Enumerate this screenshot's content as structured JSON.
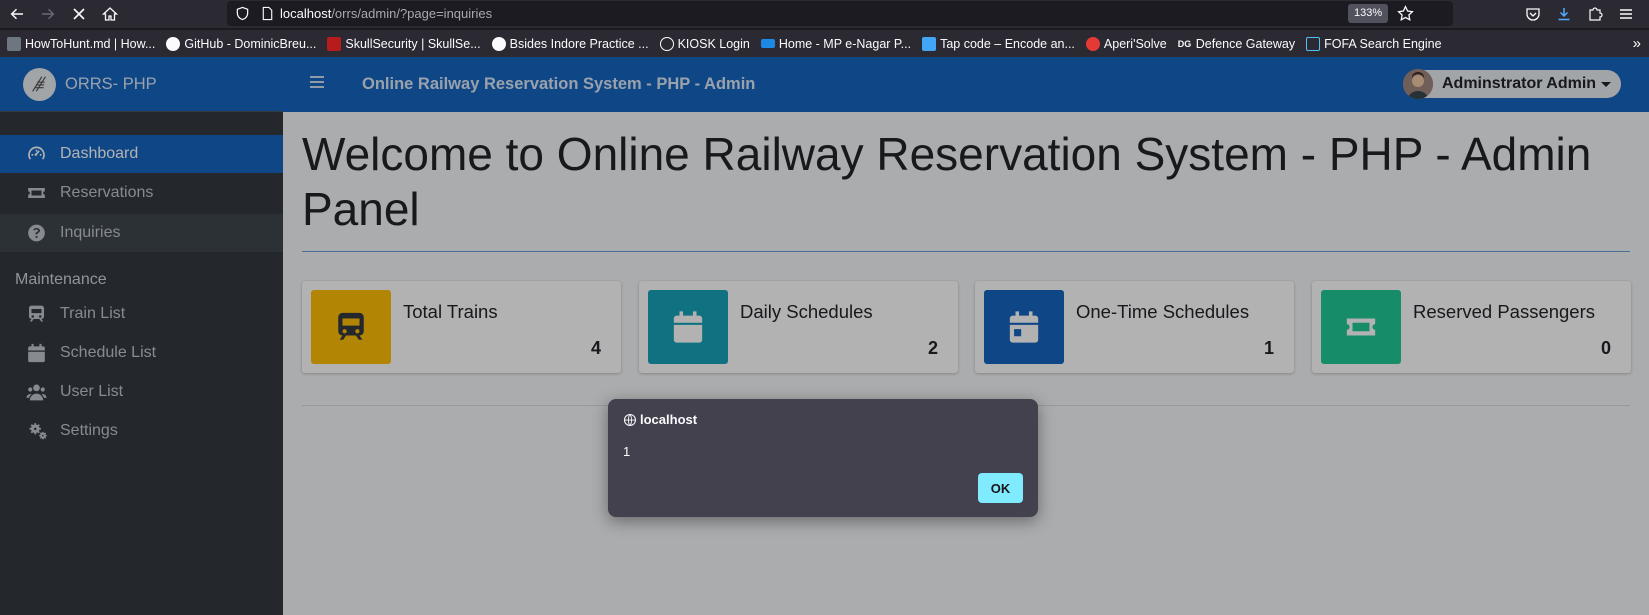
{
  "browser": {
    "url_host": "localhost",
    "url_path": "/orrs/admin/?page=inquiries",
    "zoom": "133%",
    "bookmarks": [
      {
        "label": "HowToHunt.md | How...",
        "color": "#6e7681"
      },
      {
        "label": "GitHub - DominicBreu...",
        "color": "#fbfbfe"
      },
      {
        "label": "SkullSecurity | SkullSe...",
        "color": "#b71c1c"
      },
      {
        "label": "Bsides Indore Practice ...",
        "color": "#fbfbfe"
      },
      {
        "label": "KIOSK Login",
        "color": "#fbfbfe"
      },
      {
        "label": "Home - MP e-Nagar P...",
        "color": "#1e88e5"
      },
      {
        "label": "Tap code – Encode an...",
        "color": "#42a5f5"
      },
      {
        "label": "Aperi'Solve",
        "color": "#e53935"
      },
      {
        "label": "Defence Gateway",
        "color": "#fbfbfe"
      },
      {
        "label": "FOFA Search Engine",
        "color": "#4fc3f7"
      }
    ]
  },
  "app": {
    "brand": "ORRS- PHP",
    "top_title": "Online Railway Reservation System - PHP - Admin",
    "user_name": "Adminstrator Admin",
    "sidebar": {
      "items": [
        {
          "label": "Dashboard",
          "icon": "tachometer-icon"
        },
        {
          "label": "Reservations",
          "icon": "ticket-icon"
        },
        {
          "label": "Inquiries",
          "icon": "question-circle-icon"
        }
      ],
      "maintenance_header": "Maintenance",
      "maintenance_items": [
        {
          "label": "Train List",
          "icon": "train-icon"
        },
        {
          "label": "Schedule List",
          "icon": "calendar-icon"
        },
        {
          "label": "User List",
          "icon": "users-icon"
        },
        {
          "label": "Settings",
          "icon": "cogs-icon"
        }
      ]
    },
    "heading": "Welcome to Online Railway Reservation System - PHP - Admin Panel",
    "cards": [
      {
        "label": "Total Trains",
        "value": "4",
        "color": "#ffc107",
        "icon": "train-icon"
      },
      {
        "label": "Daily Schedules",
        "value": "2",
        "color": "#17a2b8",
        "icon": "calendar-icon"
      },
      {
        "label": "One-Time Schedules",
        "value": "1",
        "color": "#1565c0",
        "icon": "calendar-day-icon"
      },
      {
        "label": "Reserved Passengers",
        "value": "0",
        "color": "#20c997",
        "icon": "ticket-icon"
      }
    ]
  },
  "dialog": {
    "title": "localhost",
    "message": "1",
    "ok_label": "OK"
  }
}
